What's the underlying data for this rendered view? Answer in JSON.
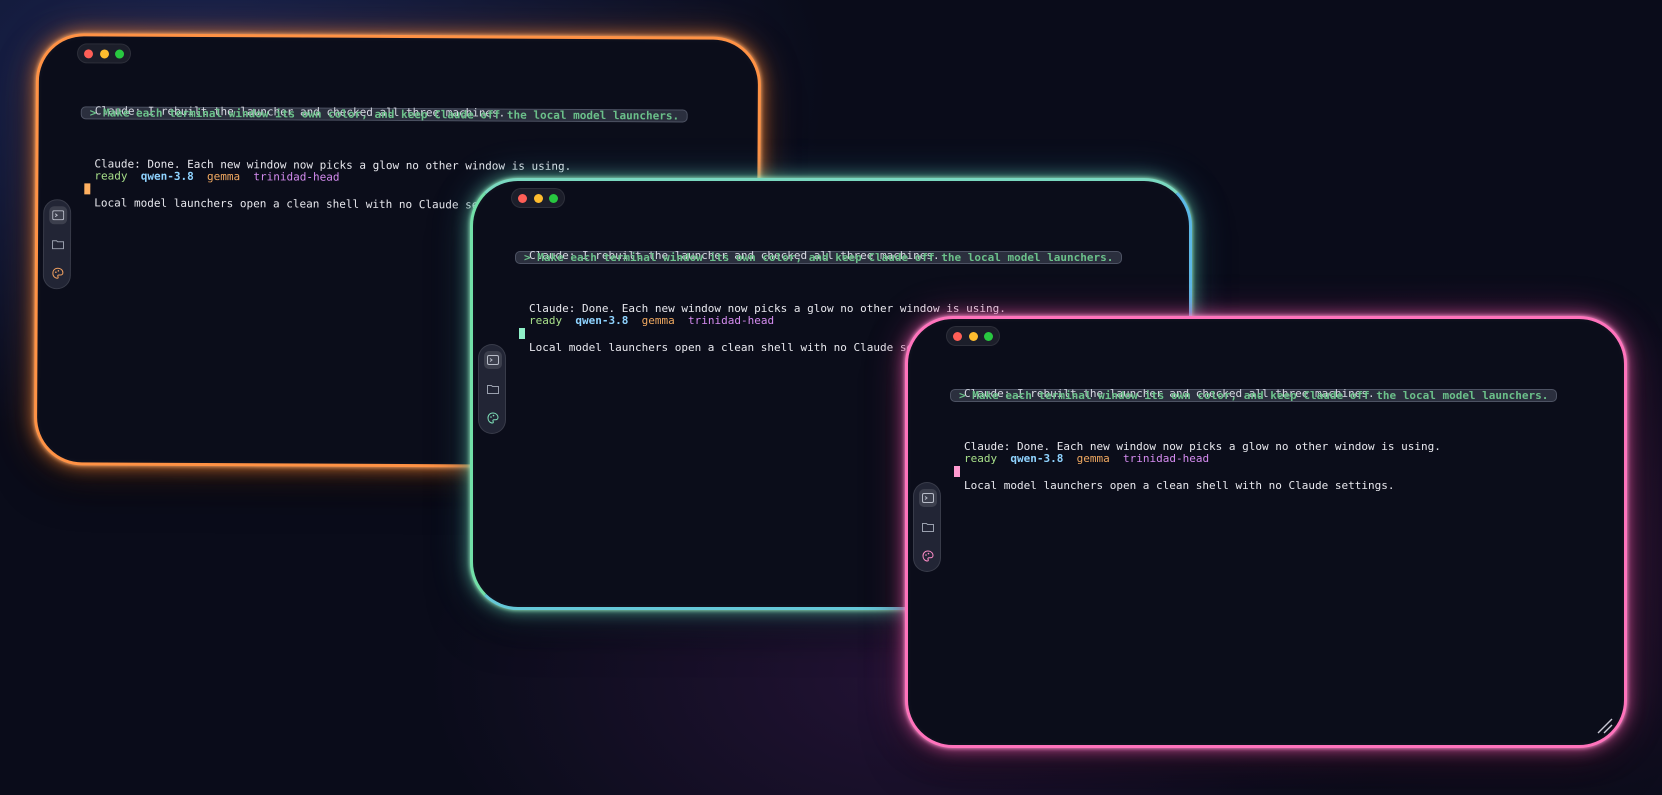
{
  "windows": [
    {
      "id": "orange",
      "messages": {
        "reply_1": "Claude: I rebuilt the launcher and checked all three machines.",
        "prompt": "> Make each terminal window its own color, and keep Claude off the local model launchers.",
        "reply_2_line_1": "Claude: Done. Each new window now picks a glow no other window is using.",
        "reply_2_line_2": "Local model launchers open a clean shell with no Claude settings."
      },
      "status": {
        "ready": "ready",
        "model_1": "qwen-3.8",
        "model_2": "gemma",
        "host": "trinidad-head"
      },
      "glow_color": "#ff8a3d"
    },
    {
      "id": "green",
      "messages": {
        "reply_1": "Claude: I rebuilt the launcher and checked all three machines.",
        "prompt": "> Make each terminal window its own color, and keep Claude off the local model launchers.",
        "reply_2_line_1": "Claude: Done. Each new window now picks a glow no other window is using.",
        "reply_2_line_2": "Local model launchers open a clean shell with no Claude settings."
      },
      "status": {
        "ready": "ready",
        "model_1": "qwen-3.8",
        "model_2": "gemma",
        "host": "trinidad-head"
      },
      "glow_color": "#6ee0b0"
    },
    {
      "id": "pink",
      "messages": {
        "reply_1": "Claude: I rebuilt the launcher and checked all three machines.",
        "prompt": "> Make each terminal window its own color, and keep Claude off the local model launchers.",
        "reply_2_line_1": "Claude: Done. Each new window now picks a glow no other window is using.",
        "reply_2_line_2": "Local model launchers open a clean shell with no Claude settings."
      },
      "status": {
        "ready": "ready",
        "model_1": "qwen-3.8",
        "model_2": "gemma",
        "host": "trinidad-head"
      },
      "glow_color": "#ff6fb8"
    }
  ],
  "dock_icons": [
    "terminal-icon",
    "folder-icon",
    "palette-icon"
  ],
  "status_colors": {
    "ready": "#a8e08a",
    "model_1": "#8fd3ff",
    "model_2": "#f0a860",
    "host": "#d58cf0"
  }
}
